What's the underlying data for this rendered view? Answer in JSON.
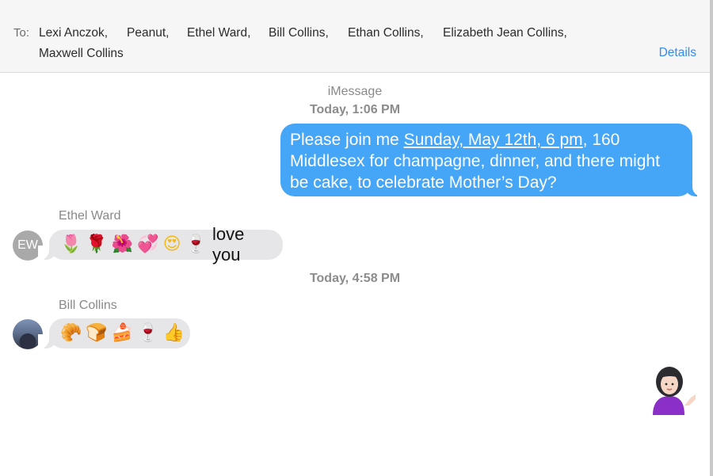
{
  "header": {
    "to_label": "To:",
    "recipients": [
      "Lexi Anczok,",
      "Peanut,",
      "Ethel Ward,",
      "Bill Collins,",
      "Ethan Collins,",
      "Elizabeth Jean Collins,",
      "Maxwell Collins"
    ],
    "details_label": "Details"
  },
  "conversation": {
    "service_label": "iMessage",
    "timestamp_1": "Today, 1:06 PM",
    "outgoing": {
      "text_before": "Please join me ",
      "date_link": "Sunday, May 12th, 6 pm",
      "text_after": ", 160 Middlesex for champagne, dinner, and there might be cake, to celebrate Mother’s Day?",
      "bubble_color": "#45a5f7"
    },
    "message_2": {
      "sender": "Ethel Ward",
      "avatar_initials": "EW",
      "emojis": [
        "🌷",
        "🌹",
        "🌺",
        "💞",
        "😍",
        "🍷"
      ],
      "text": "love you"
    },
    "timestamp_2": "Today, 4:58 PM",
    "message_3": {
      "sender": "Bill Collins",
      "emojis": [
        "🥐",
        "🍞",
        "🍰",
        "🍷",
        "👍"
      ]
    },
    "outgoing_emoji": "woman-tipping-hand-emoji"
  }
}
